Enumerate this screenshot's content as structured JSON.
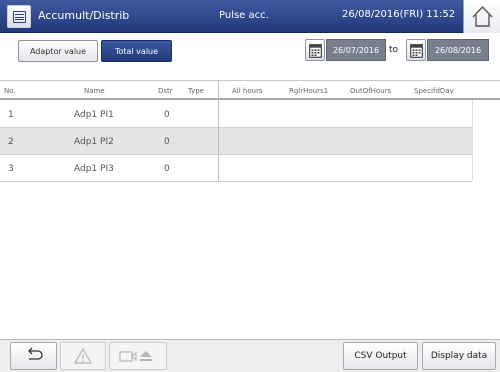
{
  "header": {
    "title": "Accumult/Distrib",
    "mode": "Pulse acc.",
    "datetime": "26/08/2016(FRI) 11:52"
  },
  "toolbar": {
    "adaptor_label": "Adaptor value",
    "total_label": "Total value",
    "date_from": "26/07/2016",
    "to_label": "to",
    "date_to": "26/08/2016"
  },
  "table": {
    "columns": [
      "No.",
      "Name",
      "Dstr",
      "Type",
      "All hours",
      "RglrHours1",
      "OutOfHours",
      "SpecifdDay"
    ],
    "rows": [
      {
        "no": "1",
        "name": "Adp1 PI1",
        "dstr": "0"
      },
      {
        "no": "2",
        "name": "Adp1 PI2",
        "dstr": "0"
      },
      {
        "no": "3",
        "name": "Adp1 PI3",
        "dstr": "0"
      }
    ]
  },
  "footer": {
    "csv_label": "CSV Output",
    "display_label": "Display data"
  },
  "colors": {
    "header_bg": "#2b4289",
    "selected_button": "#2b4289",
    "date_field": "#7a7f8e",
    "selected_row": "#e4e4e4"
  },
  "icons": [
    "menu-icon",
    "home-icon",
    "calendar-icon",
    "back-icon",
    "warning-icon",
    "camera-eject-icon"
  ]
}
